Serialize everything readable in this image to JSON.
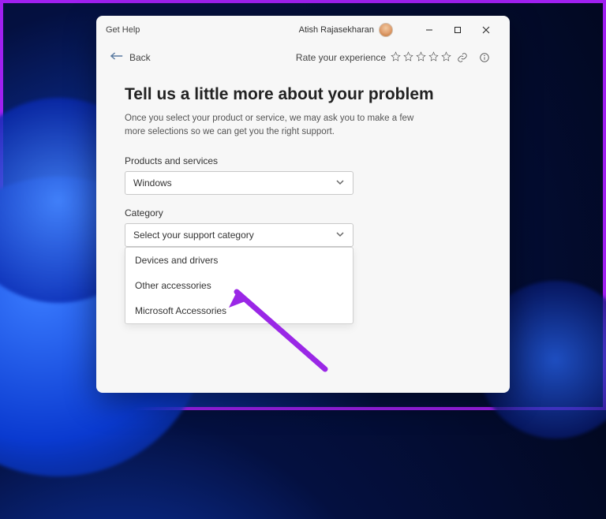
{
  "titlebar": {
    "app_name": "Get Help",
    "user_name": "Atish Rajasekharan"
  },
  "topbar": {
    "back_label": "Back",
    "rate_label": "Rate your experience"
  },
  "content": {
    "heading": "Tell us a little more about your problem",
    "subtext": "Once you select your product or service, we may ask you to make a few more selections so we can get you the right support."
  },
  "products": {
    "label": "Products and services",
    "value": "Windows"
  },
  "category": {
    "label": "Category",
    "placeholder": "Select your support category",
    "options": [
      "Devices and drivers",
      "Other accessories",
      "Microsoft Accessories"
    ]
  }
}
